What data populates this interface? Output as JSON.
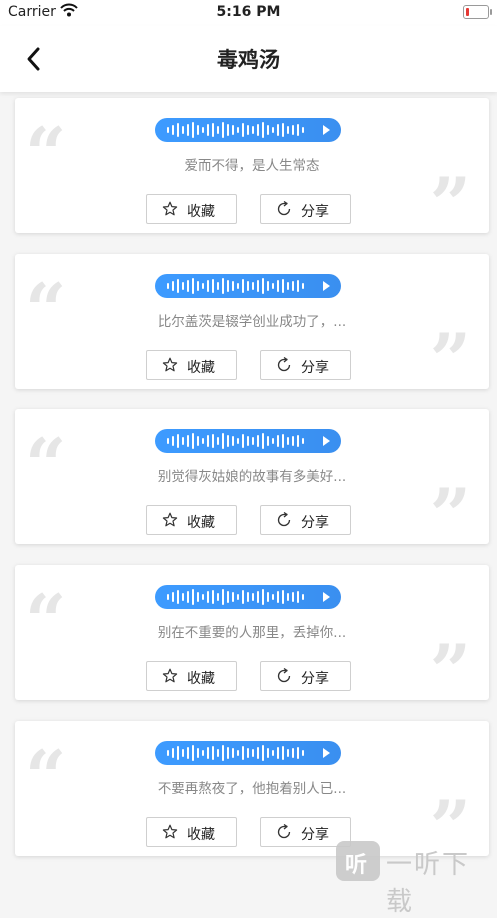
{
  "status_bar": {
    "carrier": "Carrier",
    "time": "5:16 PM"
  },
  "nav": {
    "title": "毒鸡汤"
  },
  "cards": [
    {
      "text": "爱而不得，是人生常态",
      "fav_label": "收藏",
      "share_label": "分享"
    },
    {
      "text": "比尔盖茨是辍学创业成功了，...",
      "fav_label": "收藏",
      "share_label": "分享"
    },
    {
      "text": "别觉得灰姑娘的故事有多美好...",
      "fav_label": "收藏",
      "share_label": "分享"
    },
    {
      "text": "别在不重要的人那里，丢掉你...",
      "fav_label": "收藏",
      "share_label": "分享"
    },
    {
      "text": "不要再熬夜了，他抱着别人已...",
      "fav_label": "收藏",
      "share_label": "分享"
    }
  ],
  "quote_open": "“",
  "quote_close": "”",
  "watermark": {
    "logo_char": "听",
    "text": "一听下载"
  },
  "colors": {
    "accent": "#3d9bff",
    "battery_low": "#e53935"
  }
}
